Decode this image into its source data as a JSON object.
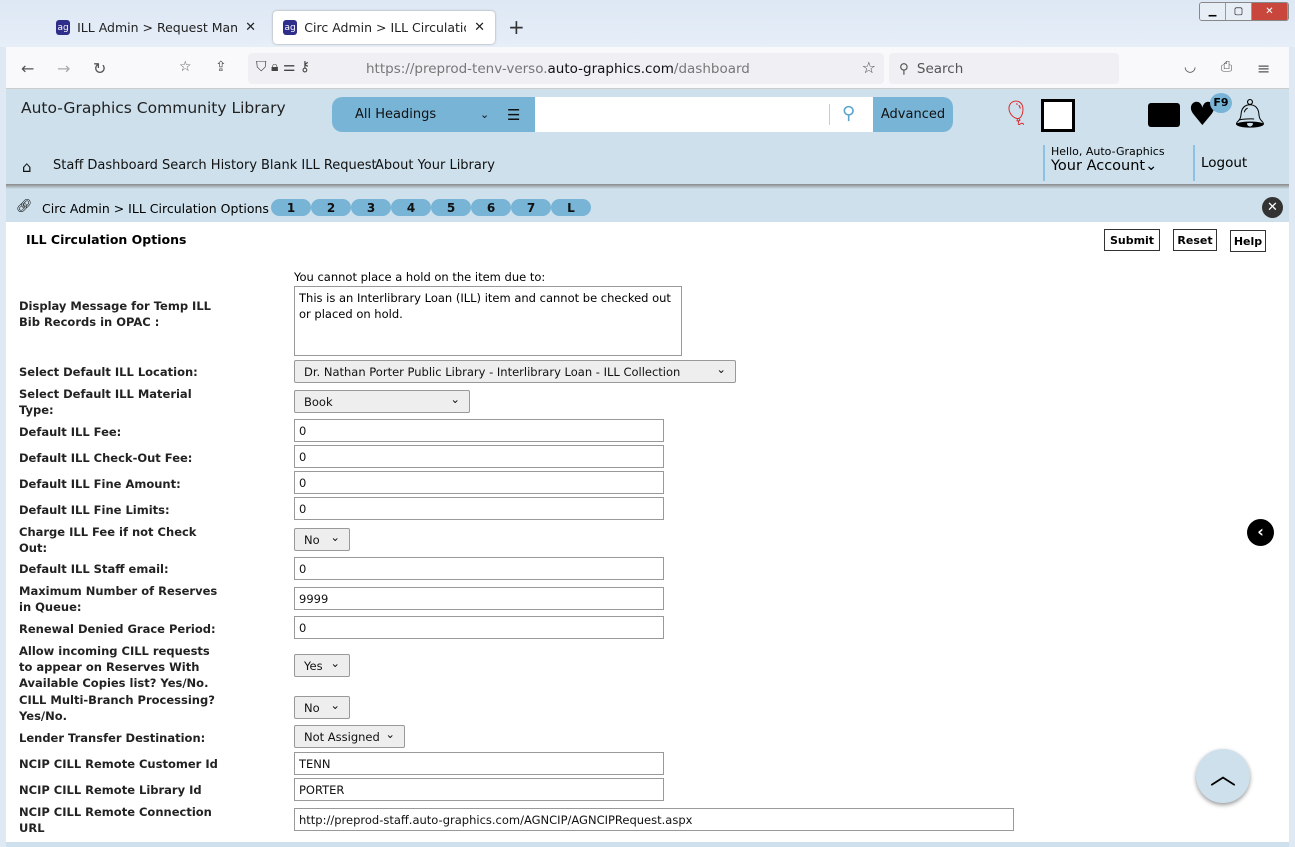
{
  "browser": {
    "tabs": [
      {
        "title": "ILL Admin > Request Manager |"
      },
      {
        "title": "Circ Admin > ILL Circulation Op"
      }
    ],
    "url_prefix": "https://preprod-tenv-verso.",
    "url_domain": "auto-graphics.com",
    "url_path": "/dashboard",
    "search_placeholder": "Search"
  },
  "header": {
    "library_name": "Auto-Graphics Community Library",
    "search_type": "All Headings",
    "advanced_label": "Advanced",
    "badge": "F9",
    "menu": [
      "Staff Dashboard",
      "Search History",
      "Blank ILL Request",
      "About Your Library"
    ],
    "greeting": "Hello, Auto-Graphics",
    "account": "Your Account",
    "logout": "Logout"
  },
  "breadcrumb": "Circ Admin > ILL Circulation Options",
  "pages": [
    "1",
    "2",
    "3",
    "4",
    "5",
    "6",
    "7",
    "L"
  ],
  "page_title": "ILL Circulation Options",
  "buttons": {
    "submit": "Submit",
    "reset": "Reset",
    "help": "Help"
  },
  "form": {
    "message_caption": "You cannot place a hold on the item due to:",
    "message_label": "Display Message for Temp ILL Bib Records in OPAC :",
    "message_value": "This is an Interlibrary Loan (ILL) item and cannot be checked out or placed on hold.",
    "fields": [
      {
        "label": "Select Default ILL Location:",
        "value": "Dr. Nathan Porter Public Library - Interlibrary Loan - ILL Collection"
      },
      {
        "label": "Select Default ILL Material Type:",
        "value": "Book"
      },
      {
        "label": "Default ILL Fee:",
        "value": "0"
      },
      {
        "label": "Default ILL Check-Out Fee:",
        "value": "0"
      },
      {
        "label": "Default ILL Fine Amount:",
        "value": "0"
      },
      {
        "label": "Default ILL Fine Limits:",
        "value": "0"
      },
      {
        "label": "Charge ILL Fee if not Check Out:",
        "value": "No"
      },
      {
        "label": "Default ILL Staff email:",
        "value": "0"
      },
      {
        "label": "Maximum Number of Reserves in Queue:",
        "value": "9999"
      },
      {
        "label": "Renewal Denied Grace Period:",
        "value": "0"
      },
      {
        "label": "Allow incoming CILL requests to appear on Reserves With Available Copies list? Yes/No.",
        "value": "Yes"
      },
      {
        "label": "CILL Multi-Branch Processing? Yes/No.",
        "value": "No"
      },
      {
        "label": "Lender Transfer Destination:",
        "value": "Not Assigned"
      },
      {
        "label": "NCIP CILL Remote Customer Id",
        "value": "TENN"
      },
      {
        "label": "NCIP CILL Remote Library Id",
        "value": "PORTER"
      },
      {
        "label": "NCIP CILL Remote Connection URL",
        "value": "http://preprod-staff.auto-graphics.com/AGNCIP/AGNCIPRequest.aspx"
      }
    ]
  }
}
